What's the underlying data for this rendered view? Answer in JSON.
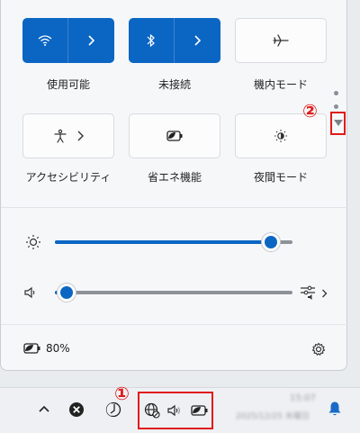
{
  "quick_settings": {
    "tiles": [
      {
        "label": "使用可能",
        "icon": "wifi-icon",
        "active": true,
        "split": true
      },
      {
        "label": "未接続",
        "icon": "bluetooth-icon",
        "active": true,
        "split": true
      },
      {
        "label": "機内モード",
        "icon": "airplane-icon",
        "active": false,
        "split": false
      },
      {
        "label": "アクセシビリティ",
        "icon": "accessibility-icon",
        "active": false,
        "split": false
      },
      {
        "label": "省エネ機能",
        "icon": "energy-saver-icon",
        "active": false,
        "split": false
      },
      {
        "label": "夜間モード",
        "icon": "night-light-icon",
        "active": false,
        "split": false
      }
    ],
    "brightness": {
      "icon": "brightness-icon",
      "level": 0.91
    },
    "volume": {
      "icon": "speaker-icon",
      "level": 0.05,
      "mixer_icon": "volume-mixer-icon"
    },
    "battery": {
      "icon": "battery-saver-icon",
      "text": "80%"
    },
    "settings_icon": "gear-icon"
  },
  "taskbar": {
    "icons": [
      "chevron-up-icon",
      "close-circle-icon",
      "half-moon-icon",
      "network-icon",
      "speaker-icon",
      "battery-icon",
      "bell-icon"
    ],
    "blurred_time": "15:07",
    "blurred_date": "2025/12/25 木曜日"
  },
  "annotations": {
    "marker_1": "①",
    "marker_2": "②"
  },
  "colors": {
    "accent": "#0b66c3",
    "annotation": "#e01b1b"
  }
}
